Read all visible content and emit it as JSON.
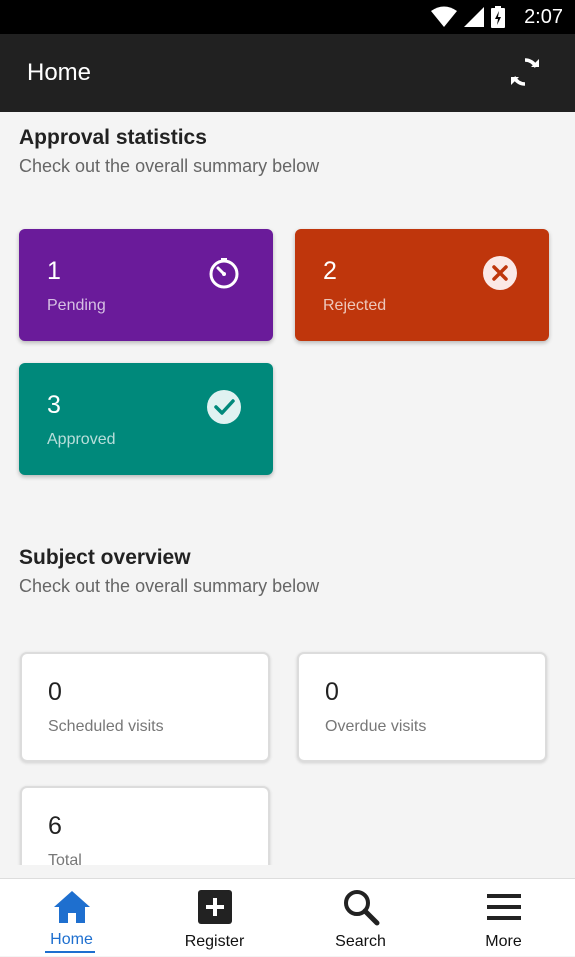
{
  "status_bar": {
    "time": "2:07"
  },
  "app_bar": {
    "title": "Home"
  },
  "approval": {
    "title": "Approval statistics",
    "subtitle": "Check out the overall summary below",
    "cards": [
      {
        "value": "1",
        "label": "Pending",
        "color": "#6a1b9a",
        "icon": "timer-icon"
      },
      {
        "value": "2",
        "label": "Rejected",
        "color": "#bf360c",
        "icon": "cancel-icon"
      },
      {
        "value": "3",
        "label": "Approved",
        "color": "#00897b",
        "icon": "check-circle-icon"
      }
    ]
  },
  "subject": {
    "title": "Subject overview",
    "subtitle": "Check out the overall summary below",
    "cards": [
      {
        "value": "0",
        "label": "Scheduled visits"
      },
      {
        "value": "0",
        "label": "Overdue visits"
      },
      {
        "value": "6",
        "label": "Total"
      }
    ]
  },
  "bottom_nav": {
    "items": [
      {
        "label": "Home",
        "icon": "home-icon",
        "active": true
      },
      {
        "label": "Register",
        "icon": "add-box-icon"
      },
      {
        "label": "Search",
        "icon": "search-icon"
      },
      {
        "label": "More",
        "icon": "menu-icon"
      }
    ],
    "accent": "#1e6fcf"
  }
}
